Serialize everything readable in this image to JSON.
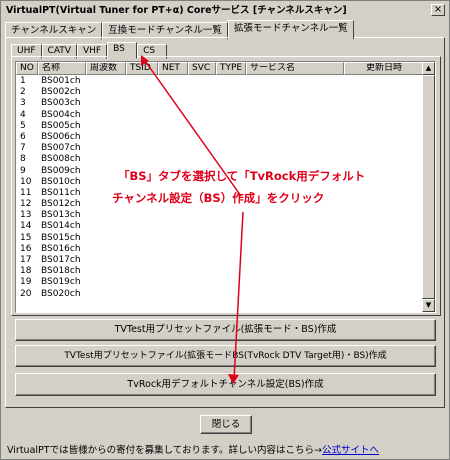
{
  "window": {
    "title": "VirtualPT(Virtual Tuner for PT+α) Coreサービス [チャンネルスキャン]",
    "close_glyph": "×"
  },
  "main_tabs": [
    {
      "label": "チャンネルスキャン"
    },
    {
      "label": "互換モードチャンネル一覧"
    },
    {
      "label": "拡張モードチャンネル一覧",
      "active": true
    }
  ],
  "sub_tabs": [
    {
      "label": "UHF"
    },
    {
      "label": "CATV"
    },
    {
      "label": "VHF"
    },
    {
      "label": "BS",
      "active": true
    },
    {
      "label": "CS"
    }
  ],
  "table": {
    "columns": [
      "NO",
      "名称",
      "周波数",
      "TSID",
      "NET",
      "SVC",
      "TYPE",
      "サービス名",
      "更新日時"
    ],
    "rows": [
      [
        "1",
        "BS001ch"
      ],
      [
        "2",
        "BS002ch"
      ],
      [
        "3",
        "BS003ch"
      ],
      [
        "4",
        "BS004ch"
      ],
      [
        "5",
        "BS005ch"
      ],
      [
        "6",
        "BS006ch"
      ],
      [
        "7",
        "BS007ch"
      ],
      [
        "8",
        "BS008ch"
      ],
      [
        "9",
        "BS009ch"
      ],
      [
        "10",
        "BS010ch"
      ],
      [
        "11",
        "BS011ch"
      ],
      [
        "12",
        "BS012ch"
      ],
      [
        "13",
        "BS013ch"
      ],
      [
        "14",
        "BS014ch"
      ],
      [
        "15",
        "BS015ch"
      ],
      [
        "16",
        "BS016ch"
      ],
      [
        "17",
        "BS017ch"
      ],
      [
        "18",
        "BS018ch"
      ],
      [
        "19",
        "BS019ch"
      ],
      [
        "20",
        "BS020ch"
      ]
    ]
  },
  "buttons": {
    "preset_ext_bs": "TVTest用プリセットファイル(拡張モード・BS)作成",
    "preset_ext_bs_tvrock": "TVTest用プリセットファイル(拡張モードBS(TvRock DTV Target用)・BS)作成",
    "tvrock_default": "TvRock用デフォルトチャンネル設定(BS)作成",
    "close": "閉じる"
  },
  "annotation": {
    "line1": "「BS」タブを選択して「TvRock用デフォルト",
    "line2": "チャンネル設定（BS）作成」をクリック",
    "color": "#e0001a"
  },
  "footer": {
    "text": "VirtualPTでは皆様からの寄付を募集しております。詳しい内容はこちら→",
    "link": "公式サイトへ"
  }
}
